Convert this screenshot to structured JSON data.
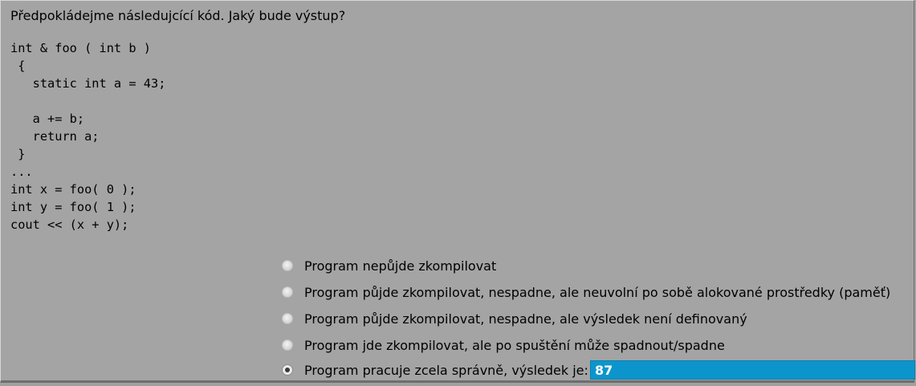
{
  "question": {
    "text": "Předpokládejme následujcící kód. Jaký bude výstup?"
  },
  "code": {
    "lines": [
      "int & foo ( int b )",
      " {",
      "   static int a = 43;",
      "",
      "   a += b;",
      "   return a;",
      " }",
      "...",
      "int x = foo( 0 );",
      "int y = foo( 1 );",
      "cout << (x + y);"
    ]
  },
  "options": [
    {
      "label": "Program nepůjde zkompilovat",
      "selected": false
    },
    {
      "label": "Program půjde zkompilovat, nespadne, ale neuvolní po sobě alokované prostředky (paměť)",
      "selected": false
    },
    {
      "label": "Program půjde zkompilovat, nespadne, ale výsledek není definovaný",
      "selected": false
    },
    {
      "label": "Program jde zkompilovat, ale po spuštění může spadnout/spadne",
      "selected": false
    },
    {
      "label": "Program pracuje zcela správně, výsledek je:",
      "selected": true
    }
  ],
  "answer": {
    "value": "87"
  },
  "colors": {
    "background": "#a4a4a4",
    "input_background": "#0c95cc",
    "input_text": "#ffffff"
  },
  "icons": {
    "option_marker": "radio-button-icon"
  }
}
